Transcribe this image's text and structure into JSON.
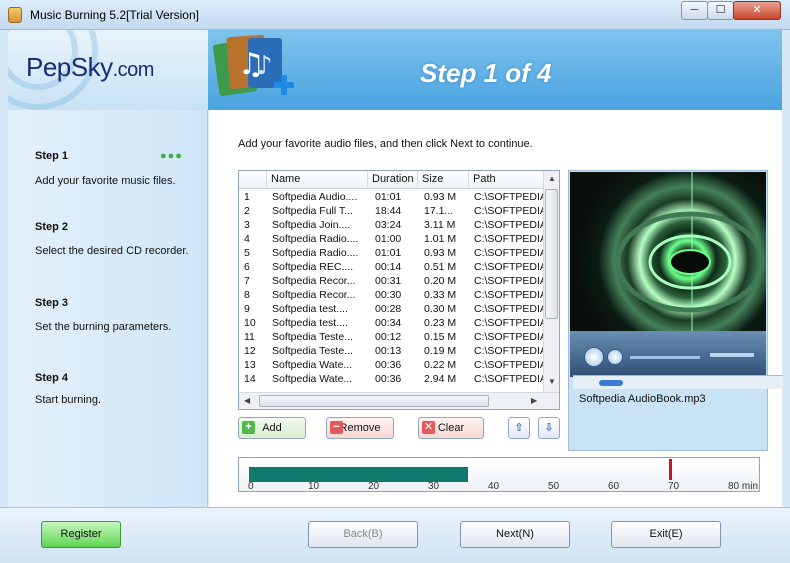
{
  "window": {
    "title": "Music Burning 5.2[Trial Version]",
    "controls": {
      "minimize": "─",
      "maximize": "☐",
      "close": "✕"
    }
  },
  "header": {
    "logo_main": "PepSky",
    "logo_suffix": ".com",
    "step_heading": "Step 1 of 4"
  },
  "sidebar": {
    "dots": "●●●",
    "steps": [
      {
        "title": "Step 1",
        "desc": "Add your favorite music files."
      },
      {
        "title": "Step 2",
        "desc": "Select the desired CD recorder."
      },
      {
        "title": "Step 3",
        "desc": "Set the burning parameters."
      },
      {
        "title": "Step 4",
        "desc": "Start burning."
      }
    ]
  },
  "main": {
    "instruction": "Add your favorite audio files, and then click Next to continue.",
    "table": {
      "columns": [
        "Name",
        "Duration",
        "Size",
        "Path"
      ],
      "rows": [
        [
          "1",
          "Softpedia Audio....",
          "01:01",
          "0.93 M",
          "C:\\SOFTPEDIA"
        ],
        [
          "2",
          "Softpedia Full T...",
          "18:44",
          "17.1...",
          "C:\\SOFTPEDIA"
        ],
        [
          "3",
          "Softpedia Join....",
          "03:24",
          "3.11 M",
          "C:\\SOFTPEDIA"
        ],
        [
          "4",
          "Softpedia Radio....",
          "01:00",
          "1.01 M",
          "C:\\SOFTPEDIA"
        ],
        [
          "5",
          "Softpedia Radio....",
          "01:01",
          "0.93 M",
          "C:\\SOFTPEDIA"
        ],
        [
          "6",
          "Softpedia REC....",
          "00:14",
          "0.51 M",
          "C:\\SOFTPEDIA"
        ],
        [
          "7",
          "Softpedia Recor...",
          "00:31",
          "0.20 M",
          "C:\\SOFTPEDIA"
        ],
        [
          "8",
          "Softpedia Recor...",
          "00:30",
          "0.33 M",
          "C:\\SOFTPEDIA"
        ],
        [
          "9",
          "Softpedia test....",
          "00:28",
          "0.30 M",
          "C:\\SOFTPEDIA"
        ],
        [
          "10",
          "Softpedia test....",
          "00:34",
          "0.23 M",
          "C:\\SOFTPEDIA"
        ],
        [
          "11",
          "Softpedia Teste...",
          "00:12",
          "0.15 M",
          "C:\\SOFTPEDIA"
        ],
        [
          "12",
          "Softpedia Teste...",
          "00:13",
          "0.19 M",
          "C:\\SOFTPEDIA"
        ],
        [
          "13",
          "Softpedia Wate...",
          "00:36",
          "0.22 M",
          "C:\\SOFTPEDIA"
        ],
        [
          "14",
          "Softpedia Wate...",
          "00:36",
          "2.94 M",
          "C:\\SOFTPEDIA"
        ]
      ],
      "scroll_left": "◀",
      "scroll_right": "▶",
      "scroll_up": "▲",
      "scroll_down": "▼"
    },
    "preview": {
      "now_playing": "Softpedia AudioBook.mp3"
    },
    "buttons": {
      "add": "Add",
      "remove": "Remove",
      "clear": "Clear",
      "up": "⇧",
      "down": "⇩",
      "add_icon": "+",
      "remove_icon": "−",
      "clear_icon": "✕"
    },
    "ruler": {
      "used_minutes": 36.5,
      "limit_minutes": 70,
      "ticks": [
        "0",
        "10",
        "20",
        "30",
        "40",
        "50",
        "60",
        "70",
        "80 min"
      ],
      "fill_color": "#0f7a6c",
      "limit_color": "#c8151b"
    }
  },
  "footer": {
    "register": "Register",
    "back": "Back(B)",
    "next": "Next(N)",
    "exit": "Exit(E)"
  }
}
